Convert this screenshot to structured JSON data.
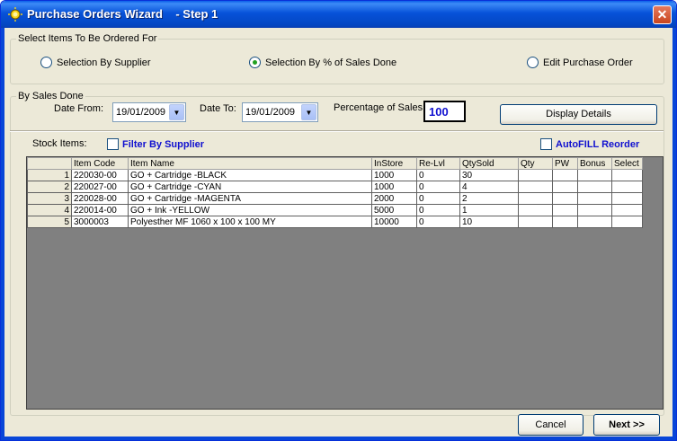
{
  "window": {
    "title": "Purchase Orders Wizard    - Step 1",
    "close_glyph": "✕"
  },
  "select_group": {
    "legend": "Select Items To Be Ordered For",
    "options": [
      {
        "label": "Selection By Supplier",
        "checked": false
      },
      {
        "label": "Selection By % of Sales Done",
        "checked": true
      },
      {
        "label": "Edit Purchase Order",
        "checked": false
      }
    ]
  },
  "sales_group": {
    "legend": "By Sales Done",
    "date_from_label": "Date From:",
    "date_from_value": "19/01/2009",
    "date_to_label": "Date To:",
    "date_to_value": "19/01/2009",
    "percentage_label": "Percentage of Sales:",
    "percentage_value": "100",
    "display_button": "Display Details"
  },
  "stock": {
    "label": "Stock Items:",
    "filter_label": "Filter By Supplier",
    "autofill_label": "AutoFILL Reorder"
  },
  "grid": {
    "columns": [
      "Item Code",
      "Item Name",
      "InStore",
      "Re-Lvl",
      "QtySold",
      "Qty",
      "PW",
      "Bonus",
      "Select"
    ],
    "rows": [
      {
        "num": "1",
        "code": "220030-00",
        "name": "GO + Cartridge  -BLACK",
        "instore": "1000",
        "relvl": "0",
        "qtysold": "30"
      },
      {
        "num": "2",
        "code": "220027-00",
        "name": "GO + Cartridge  -CYAN",
        "instore": "1000",
        "relvl": "0",
        "qtysold": "4"
      },
      {
        "num": "3",
        "code": "220028-00",
        "name": "GO + Cartridge  -MAGENTA",
        "instore": "2000",
        "relvl": "0",
        "qtysold": "2"
      },
      {
        "num": "4",
        "code": "220014-00",
        "name": "GO + Ink -YELLOW",
        "instore": "5000",
        "relvl": "0",
        "qtysold": "1"
      },
      {
        "num": "5",
        "code": "3000003",
        "name": "Polyesther MF 1060 x 100 x 100 MY",
        "instore": "10000",
        "relvl": "0",
        "qtysold": "10"
      }
    ]
  },
  "footer": {
    "cancel_label": "Cancel",
    "next_label": "Next >>"
  },
  "colors": {
    "title_bar": "#0752d9",
    "accent_text": "#1010d0",
    "grid_bg": "#808080"
  }
}
